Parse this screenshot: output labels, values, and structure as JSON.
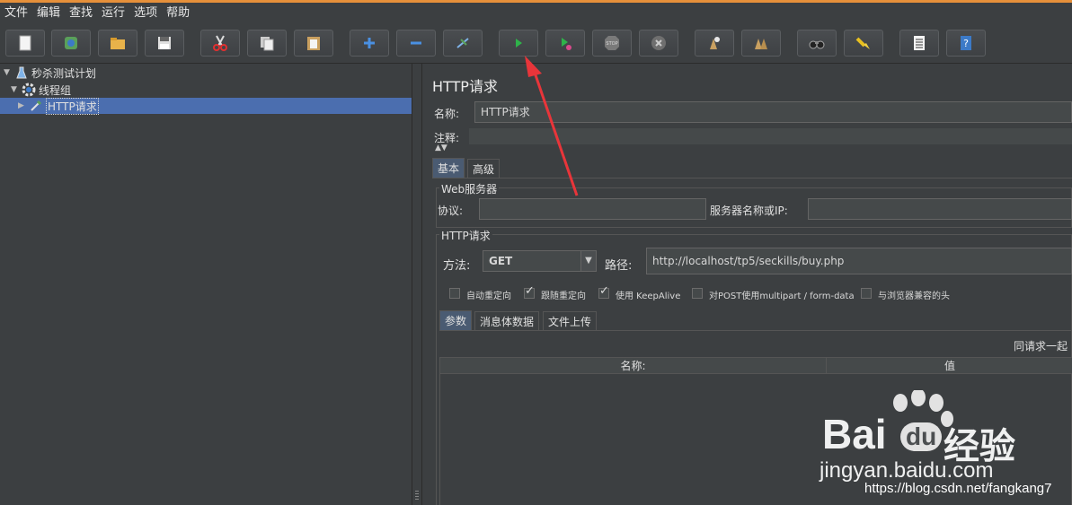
{
  "menu": [
    "文件",
    "编辑",
    "查找",
    "运行",
    "选项",
    "帮助"
  ],
  "toolbar_icons": [
    "new-icon",
    "templates-icon",
    "open-icon",
    "save-icon",
    "cut-icon",
    "copy-icon",
    "paste-icon",
    "expand-icon",
    "collapse-icon",
    "toggle-icon",
    "start-icon",
    "start-no-pauses-icon",
    "stop-icon",
    "shutdown-icon",
    "clear-icon",
    "clear-all-icon",
    "search-icon",
    "reset-search-icon",
    "function-helper-icon",
    "help-icon"
  ],
  "tree": {
    "plan": "秒杀测试计划",
    "thread_group": "线程组",
    "sampler": "HTTP请求"
  },
  "panel": {
    "title": "HTTP请求",
    "name_label": "名称:",
    "name_value": "HTTP请求",
    "comment_label": "注释:",
    "comment_value": "",
    "tabs": [
      "基本",
      "高级"
    ],
    "web_server_group": "Web服务器",
    "protocol_label": "协议:",
    "protocol_value": "",
    "server_label": "服务器名称或IP:",
    "server_value": "",
    "http_group": "HTTP请求",
    "method_label": "方法:",
    "method_value": "GET",
    "path_label": "路径:",
    "path_value": "http://localhost/tp5/seckills/buy.php",
    "checkboxes": [
      {
        "label": "自动重定向",
        "checked": false
      },
      {
        "label": "跟随重定向",
        "checked": true
      },
      {
        "label": "使用 KeepAlive",
        "checked": true
      },
      {
        "label": "对POST使用multipart / form-data",
        "checked": false
      },
      {
        "label": "与浏览器兼容的头",
        "checked": false
      }
    ],
    "sub_tabs": [
      "参数",
      "消息体数据",
      "文件上传"
    ],
    "send_with_request": "同请求一起",
    "table_headers": [
      "名称:",
      "值"
    ]
  },
  "watermark": {
    "brand": "Bai",
    "brand2": "du",
    "brand_cn": "经验",
    "site": "jingyan.baidu.com",
    "blog": "https://blog.csdn.net/fangkang7"
  },
  "colors": {
    "accent_top": "#e6903a",
    "selection": "#4b6eaf",
    "annotation_arrow": "#e8353a"
  }
}
